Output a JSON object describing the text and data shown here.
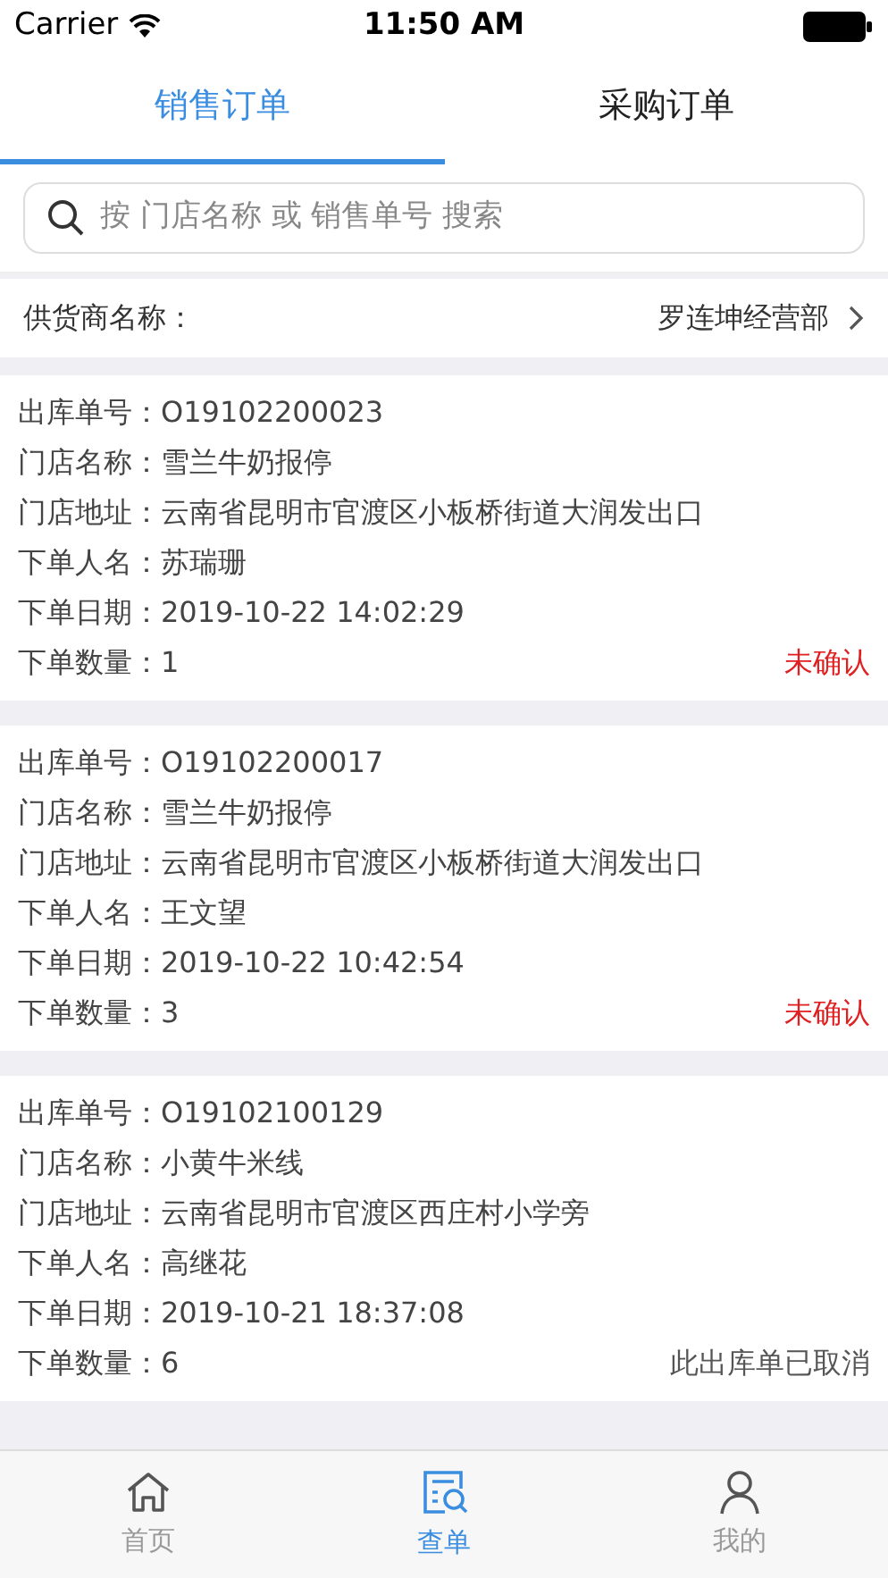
{
  "status_bar": {
    "carrier": "Carrier",
    "time": "11:50 AM"
  },
  "tabs": [
    {
      "label": "销售订单",
      "selected": true
    },
    {
      "label": "采购订单",
      "selected": false
    }
  ],
  "search": {
    "placeholder": "按 门店名称 或 销售单号 搜索"
  },
  "supplier": {
    "label": "供货商名称：",
    "value": "罗连坤经营部"
  },
  "orders": [
    {
      "fields": [
        "出库单号：O19102200023",
        "门店名称：雪兰牛奶报停",
        "门店地址：云南省昆明市官渡区小板桥街道大润发出口",
        "下单人名：苏瑞珊",
        "下单日期：2019-10-22 14:02:29",
        "下单数量：1"
      ],
      "status": {
        "text": "未确认",
        "color": "#e02020"
      }
    },
    {
      "fields": [
        "出库单号：O19102200017",
        "门店名称：雪兰牛奶报停",
        "门店地址：云南省昆明市官渡区小板桥街道大润发出口",
        "下单人名：王文望",
        "下单日期：2019-10-22 10:42:54",
        "下单数量：3"
      ],
      "status": {
        "text": "未确认",
        "color": "#e02020"
      }
    },
    {
      "fields": [
        "出库单号：O19102100129",
        "门店名称：小黄牛米线",
        "门店地址：云南省昆明市官渡区西庄村小学旁",
        "下单人名：高继花",
        "下单日期：2019-10-21 18:37:08",
        "下单数量：6"
      ],
      "status": {
        "text": "此出库单已取消",
        "color": "#555555"
      }
    }
  ],
  "bottom_nav": [
    {
      "kind": "home",
      "label": "首页",
      "selected": false
    },
    {
      "kind": "search",
      "label": "查单",
      "selected": true
    },
    {
      "kind": "user",
      "label": "我的",
      "selected": false
    }
  ]
}
